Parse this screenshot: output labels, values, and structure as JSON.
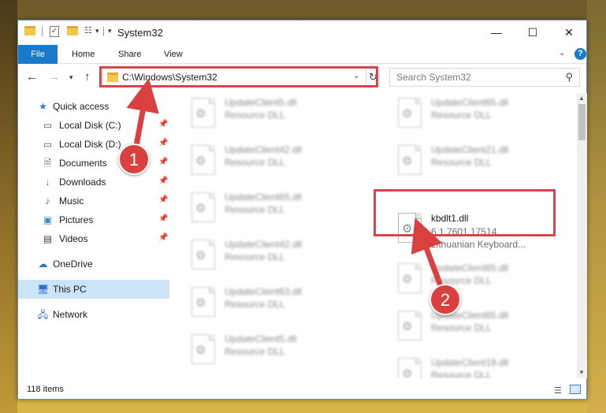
{
  "window": {
    "title": "System32",
    "controls": {
      "minimize": "—",
      "maximize": "☐",
      "close": "✕"
    }
  },
  "ribbon": {
    "tabs": [
      "File",
      "Home",
      "Share",
      "View"
    ],
    "help": "?"
  },
  "navigation": {
    "address": "C:\\Windows\\System32",
    "search_placeholder": "Search System32"
  },
  "nav_pane": {
    "quick_access": "Quick access",
    "items": [
      {
        "label": "Local Disk (C:)",
        "icon": "drive-icon"
      },
      {
        "label": "Local Disk (D:)",
        "icon": "drive-icon"
      },
      {
        "label": "Documents",
        "icon": "documents-icon"
      },
      {
        "label": "Downloads",
        "icon": "downloads-icon"
      },
      {
        "label": "Music",
        "icon": "music-icon"
      },
      {
        "label": "Pictures",
        "icon": "pictures-icon"
      },
      {
        "label": "Videos",
        "icon": "videos-icon"
      }
    ],
    "onedrive": "OneDrive",
    "this_pc": "This PC",
    "network": "Network"
  },
  "files": {
    "left": [
      {
        "name": "UpdateClient5.dll",
        "desc": "Resource DLL"
      },
      {
        "name": "UpdateClient42.dll",
        "desc": "Resource DLL"
      },
      {
        "name": "UpdateClient65.dll",
        "desc": "Resource DLL"
      },
      {
        "name": "UpdateClient42.dll",
        "desc": "Resource DLL"
      },
      {
        "name": "UpdateClient63.dll",
        "desc": "Resource DLL"
      },
      {
        "name": "UpdateClient5.dll",
        "desc": "Resource DLL"
      }
    ],
    "right": [
      {
        "name": "UpdateClient65.dll",
        "desc": "Resource DLL"
      },
      {
        "name": "UpdateClient21.dll",
        "desc": "Resource DLL"
      },
      {
        "name": "kbdlt1.dll",
        "desc": "6.1.7601.17514",
        "desc2": "Lithuanian Keyboard..."
      },
      {
        "name": "UpdateClient65.dll",
        "desc": "Resource DLL"
      },
      {
        "name": "UpdateClient65.dll",
        "desc": "Resource DLL"
      },
      {
        "name": "UpdateClient19.dll",
        "desc": "Resource DLL"
      }
    ]
  },
  "status": {
    "item_count": "118 items"
  },
  "annotations": {
    "step1": "1",
    "step2": "2",
    "color": "#d6464b"
  }
}
